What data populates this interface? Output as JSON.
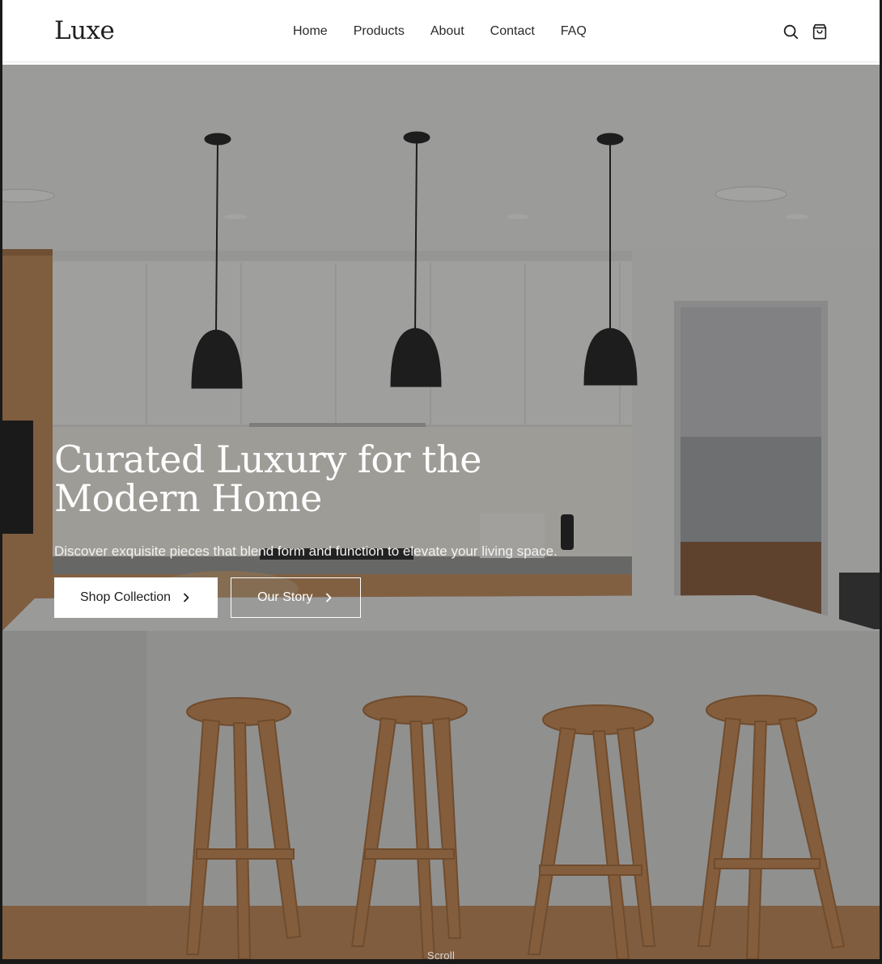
{
  "brand": {
    "name": "Luxe"
  },
  "nav": {
    "items": [
      {
        "label": "Home"
      },
      {
        "label": "Products"
      },
      {
        "label": "About"
      },
      {
        "label": "Contact"
      },
      {
        "label": "FAQ"
      }
    ]
  },
  "header_icons": {
    "search": "search-icon",
    "cart": "shopping-bag-icon"
  },
  "hero": {
    "title": "Curated Luxury for the Modern Home",
    "subtitle": "Discover exquisite pieces that blend form and function to elevate your living space.",
    "primary_cta": "Shop Collection",
    "secondary_cta": "Our Story",
    "scroll_label": "Scroll"
  },
  "colors": {
    "header_bg": "#ffffff",
    "text_dark": "#1f1f1f",
    "hero_text": "#ffffff",
    "overlay": "rgba(20,20,20,0.38)"
  }
}
